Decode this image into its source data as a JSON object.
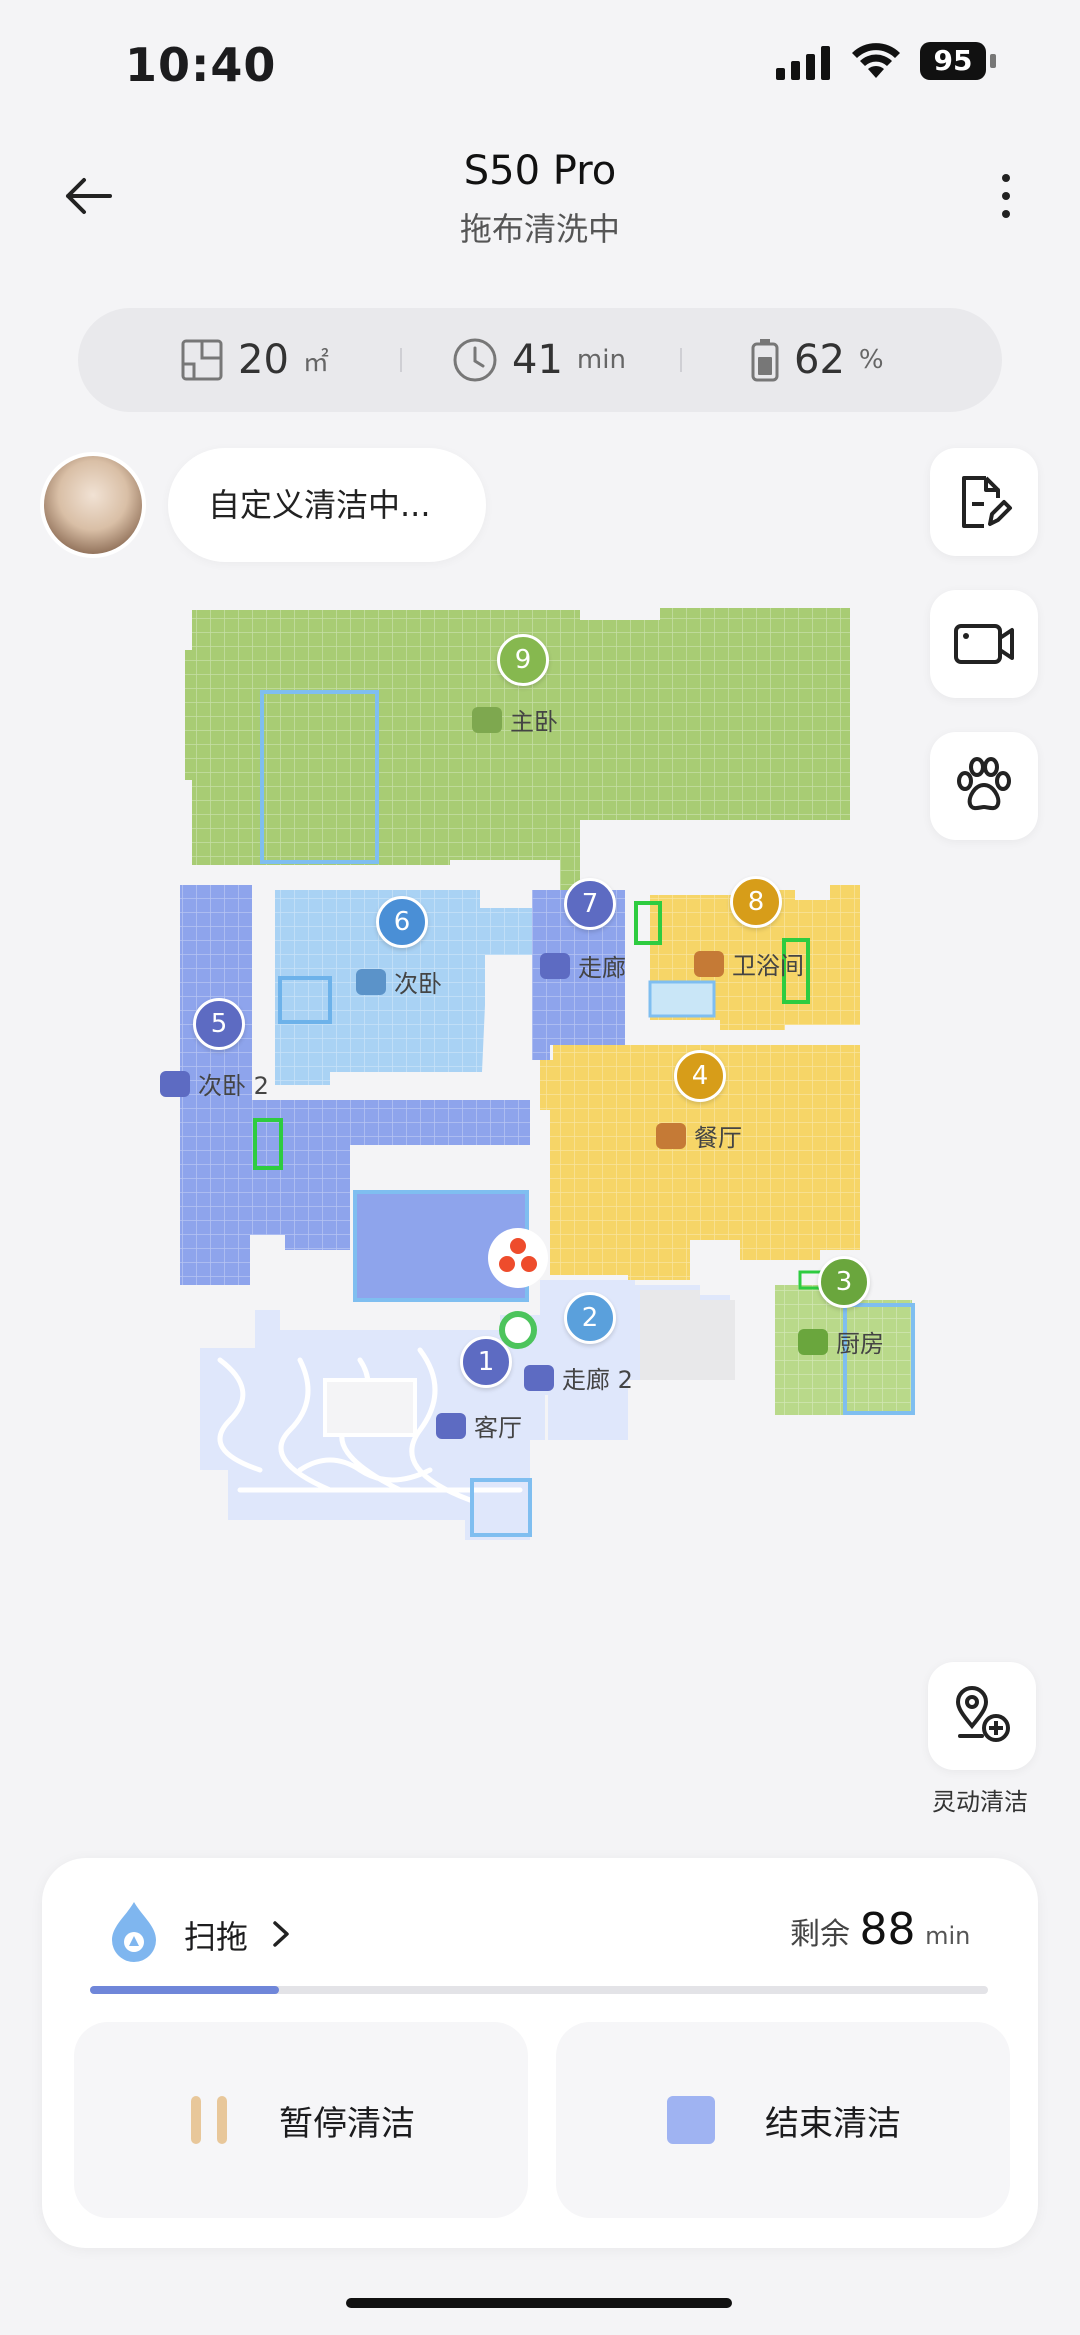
{
  "status_bar": {
    "time": "10:40",
    "battery": "95"
  },
  "header": {
    "title": "S50 Pro",
    "subtitle": "拖布清洗中"
  },
  "stats": [
    {
      "icon": "area-icon",
      "value": "20",
      "unit": "㎡"
    },
    {
      "icon": "clock-icon",
      "value": "41",
      "unit": "min"
    },
    {
      "icon": "battery-icon",
      "value": "62",
      "unit": "%"
    }
  ],
  "status_bubble": "自定义清洁中...",
  "side_buttons": [
    "edit-map-icon",
    "camera-icon",
    "paw-icon"
  ],
  "dynamic_clean": {
    "label": "灵动清洁",
    "icon": "location-add-icon"
  },
  "rooms": [
    {
      "number": "1",
      "name": "客厅",
      "color": "#dfe7fb"
    },
    {
      "number": "2",
      "name": "走廊 2",
      "color": "#dfe7fb"
    },
    {
      "number": "3",
      "name": "厨房",
      "color": "#b9d98a"
    },
    {
      "number": "4",
      "name": "餐厅",
      "color": "#f6d567"
    },
    {
      "number": "5",
      "name": "次卧 2",
      "color": "#8ea4ec"
    },
    {
      "number": "6",
      "name": "次卧",
      "color": "#a9d2f4"
    },
    {
      "number": "7",
      "name": "走廊",
      "color": "#8ea4ec"
    },
    {
      "number": "8",
      "name": "卫浴间",
      "color": "#f6d567"
    },
    {
      "number": "9",
      "name": "主卧",
      "color": "#a8cc74"
    }
  ],
  "bottom": {
    "mode": "扫拖",
    "remaining_label": "剩余",
    "remaining_value": "88",
    "remaining_unit": "min",
    "progress_fraction": 0.21,
    "pause_label": "暂停清洁",
    "stop_label": "结束清洁"
  },
  "colors": {
    "accent": "#6f86d9",
    "pause": "#e8c79a",
    "stop": "#9fb3f2"
  }
}
